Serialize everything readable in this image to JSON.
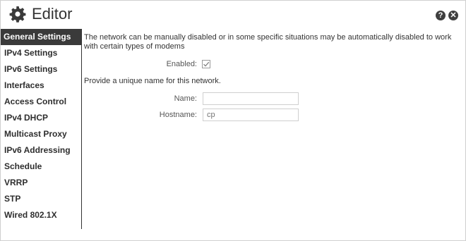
{
  "header": {
    "title": "Editor",
    "title_icon": "gear-icon",
    "help_glyph": "?",
    "close_glyph": "✕"
  },
  "sidebar": {
    "items": [
      {
        "label": "General Settings",
        "active": true
      },
      {
        "label": "IPv4 Settings"
      },
      {
        "label": "IPv6 Settings"
      },
      {
        "label": "Interfaces"
      },
      {
        "label": "Access Control"
      },
      {
        "label": "IPv4 DHCP"
      },
      {
        "label": "Multicast Proxy"
      },
      {
        "label": "IPv6 Addressing"
      },
      {
        "label": "Schedule"
      },
      {
        "label": "VRRP"
      },
      {
        "label": "STP"
      },
      {
        "label": "Wired 802.1X"
      }
    ]
  },
  "main": {
    "description": "The network can be manually disabled or in some specific situations may be automatically disabled to work with certain types of modems",
    "enabled_label": "Enabled:",
    "enabled_checked": true,
    "name_prompt": "Provide a unique name for this network.",
    "name_label": "Name:",
    "name_value": "",
    "hostname_label": "Hostname:",
    "hostname_placeholder": "cp"
  },
  "colors": {
    "active_nav_bg": "#3a3a3a",
    "header_button_bg": "#3f3f3f",
    "sidebar_divider": "#333333"
  }
}
